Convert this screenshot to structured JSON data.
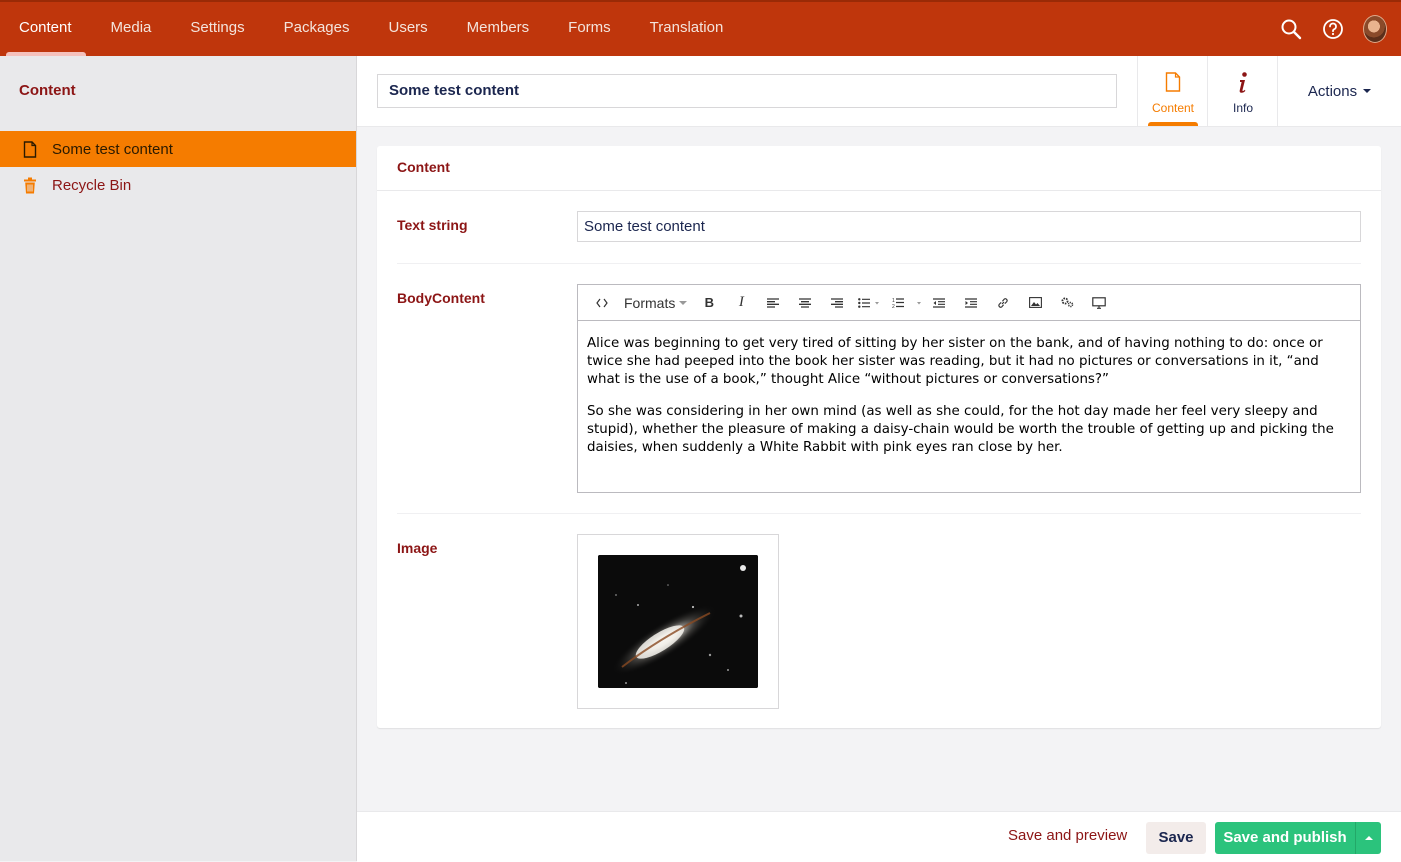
{
  "topbar": {
    "sections": [
      "Content",
      "Media",
      "Settings",
      "Packages",
      "Users",
      "Members",
      "Forms",
      "Translation"
    ],
    "active_section": "Content",
    "icons": [
      "search-icon",
      "help-icon",
      "user-avatar"
    ]
  },
  "sidebar": {
    "title": "Content",
    "items": [
      {
        "label": "Some test content",
        "icon": "document-icon",
        "selected": true
      },
      {
        "label": "Recycle Bin",
        "icon": "trash-icon",
        "selected": false
      }
    ]
  },
  "editor": {
    "name_value": "Some test content",
    "apps": [
      {
        "label": "Content",
        "icon": "document-icon",
        "active": true
      },
      {
        "label": "Info",
        "icon": "info-icon",
        "active": false
      }
    ],
    "actions_label": "Actions"
  },
  "panel": {
    "title": "Content",
    "text_string": {
      "label": "Text string",
      "value": "Some test content"
    },
    "body_content": {
      "label": "BodyContent",
      "toolbar_formats": "Formats",
      "paragraphs": [
        "Alice was beginning to get very tired of sitting by her sister on the bank, and of having nothing to do: once or twice she had peeped into the book her sister was reading, but it had no pictures or conversations in it, “and what is the use of a book,” thought Alice “without pictures or conversations?”",
        "So she was considering in her own mind (as well as she could, for the hot day made her feel very sleepy and stupid), whether the pleasure of making a daisy-chain would be worth the trouble of getting up and picking the daisies, when suddenly a White Rabbit with pink eyes ran close by her."
      ]
    },
    "image": {
      "label": "Image"
    }
  },
  "footer": {
    "save_preview_label": "Save and preview",
    "save_label": "Save",
    "publish_label": "Save and publish"
  },
  "colors": {
    "topbar": "#bf360c",
    "accent": "#f57c00",
    "publish": "#2bc37c",
    "label": "#8c1515"
  }
}
